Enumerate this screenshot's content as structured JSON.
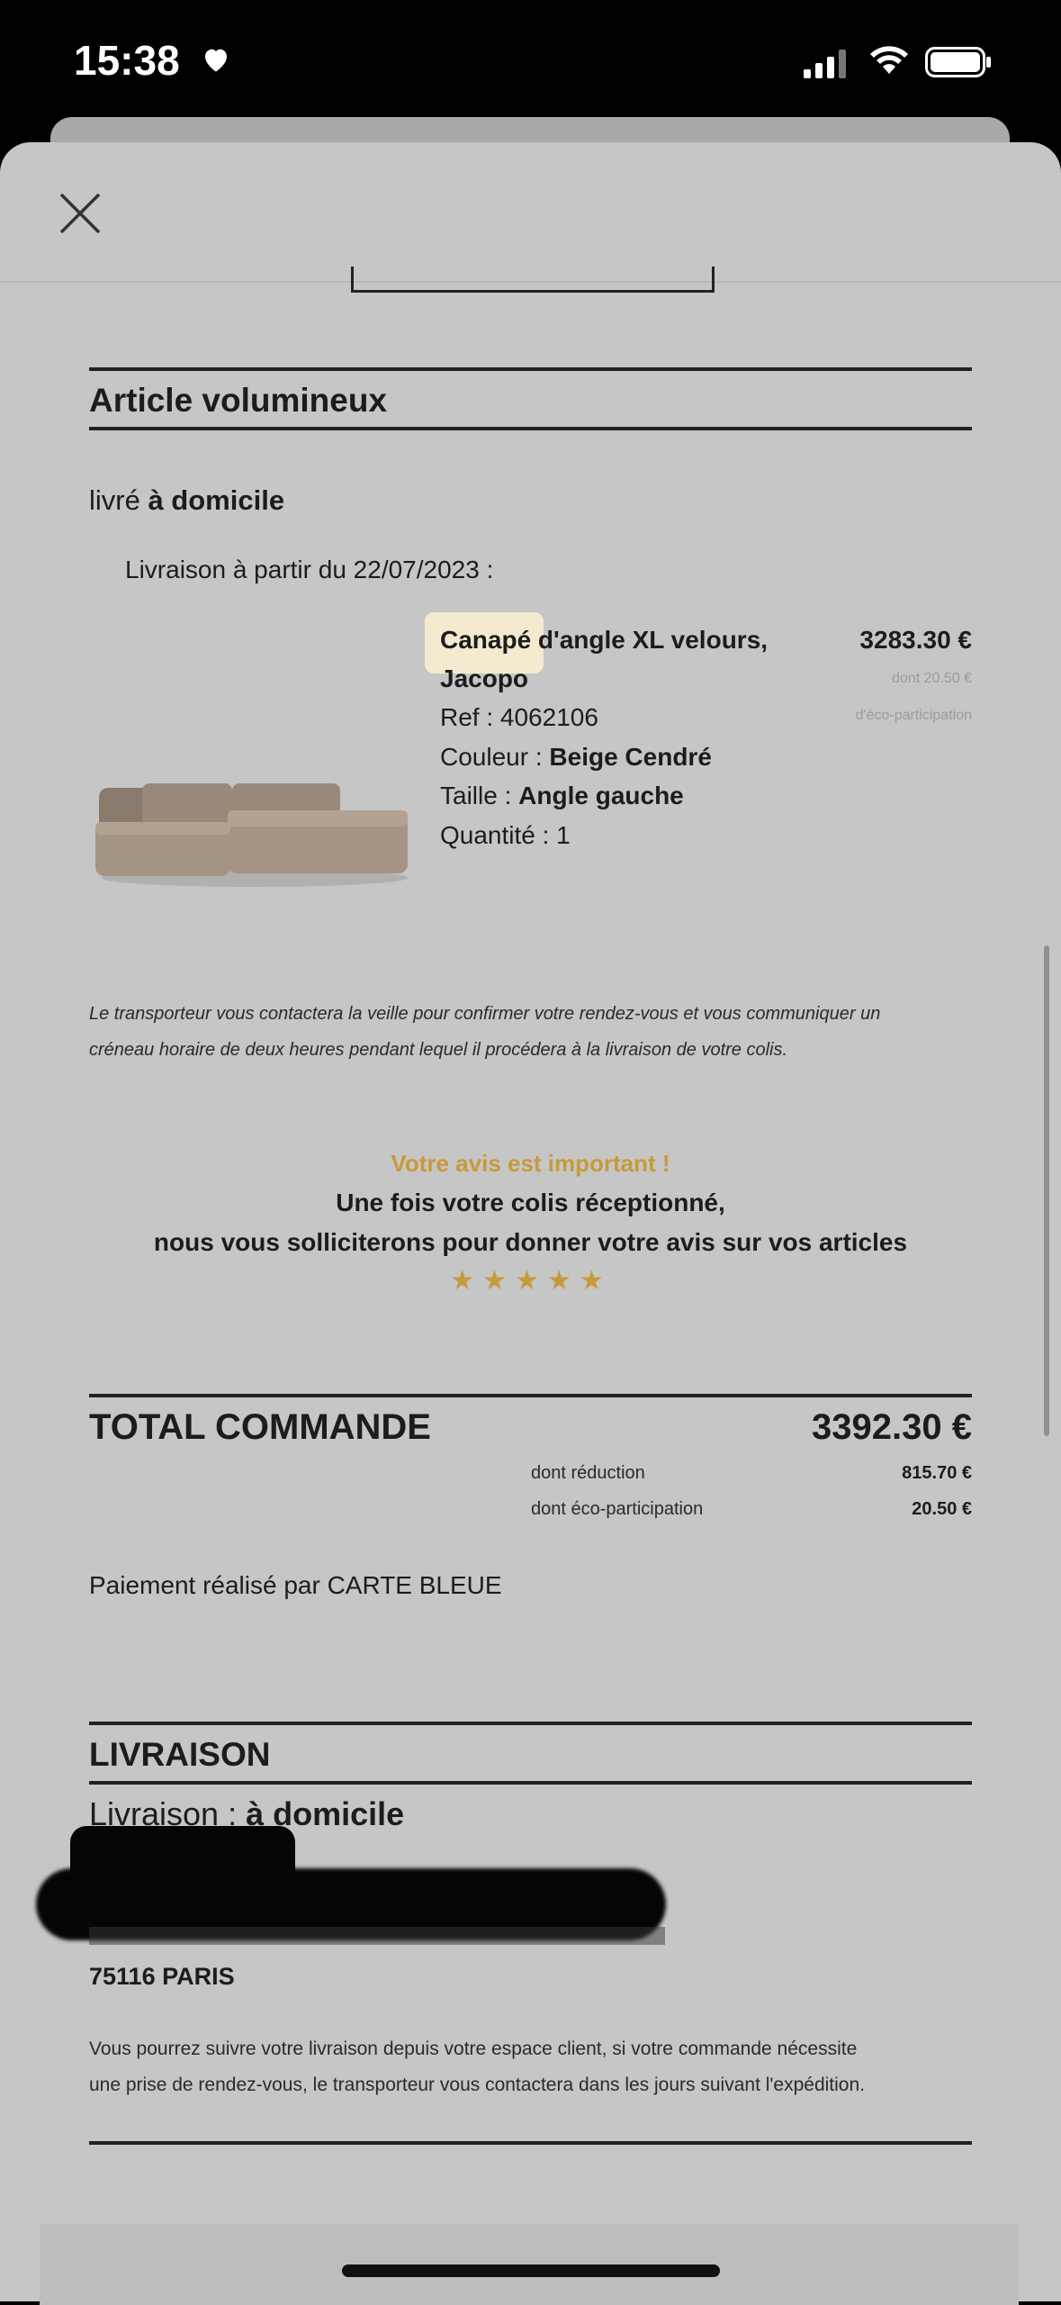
{
  "status_bar": {
    "time": "15:38"
  },
  "article": {
    "section_title": "Article volumineux",
    "delivery_prefix": "livré ",
    "delivery_mode": "à domicile",
    "delivery_date_line": "Livraison à partir du 22/07/2023 :",
    "product": {
      "name_part1": "Canapé",
      "name_part2": " d'angle XL velours,",
      "name_line2": "Jacopo",
      "ref": "Ref : 4062106",
      "color_label": "Couleur : ",
      "color_value": "Beige Cendré",
      "size_label": "Taille : ",
      "size_value": "Angle gauche",
      "quantity": "Quantité : 1",
      "price": "3283.30 €",
      "eco_line1": "dont 20.50 €",
      "eco_line2": "d'éco-participation"
    },
    "carrier_note_line1": "Le transporteur vous contactera la veille pour confirmer votre rendez-vous et vous communiquer un",
    "carrier_note_line2": "créneau horaire de deux heures pendant lequel il procédera à la livraison de votre colis."
  },
  "review": {
    "title": "Votre avis est important !",
    "line1": "Une fois votre colis réceptionné,",
    "line2": "nous vous solliciterons pour donner votre avis sur vos articles",
    "stars": "★★★★★",
    "rating_shown": 5
  },
  "total": {
    "label": "TOTAL COMMANDE",
    "value": "3392.30 €",
    "reduction_label": "dont réduction",
    "reduction_value": "815.70 €",
    "eco_label": "dont éco-participation",
    "eco_value": "20.50 €",
    "payment": "Paiement réalisé par CARTE BLEUE"
  },
  "shipping": {
    "section_title": "LIVRAISON",
    "mode_label": "Livraison : ",
    "mode_value": "à domicile",
    "city": "75116 PARIS",
    "note_line1": "Vous pourrez suivre votre livraison depuis votre espace client, si votre commande nécessite",
    "note_line2": "une prise de rendez-vous, le transporteur vous contactera dans les jours suivant l'expédition."
  },
  "colors": {
    "accent": "#c79a3a",
    "background": "#c6c6c6",
    "text": "#1c1c1c"
  }
}
